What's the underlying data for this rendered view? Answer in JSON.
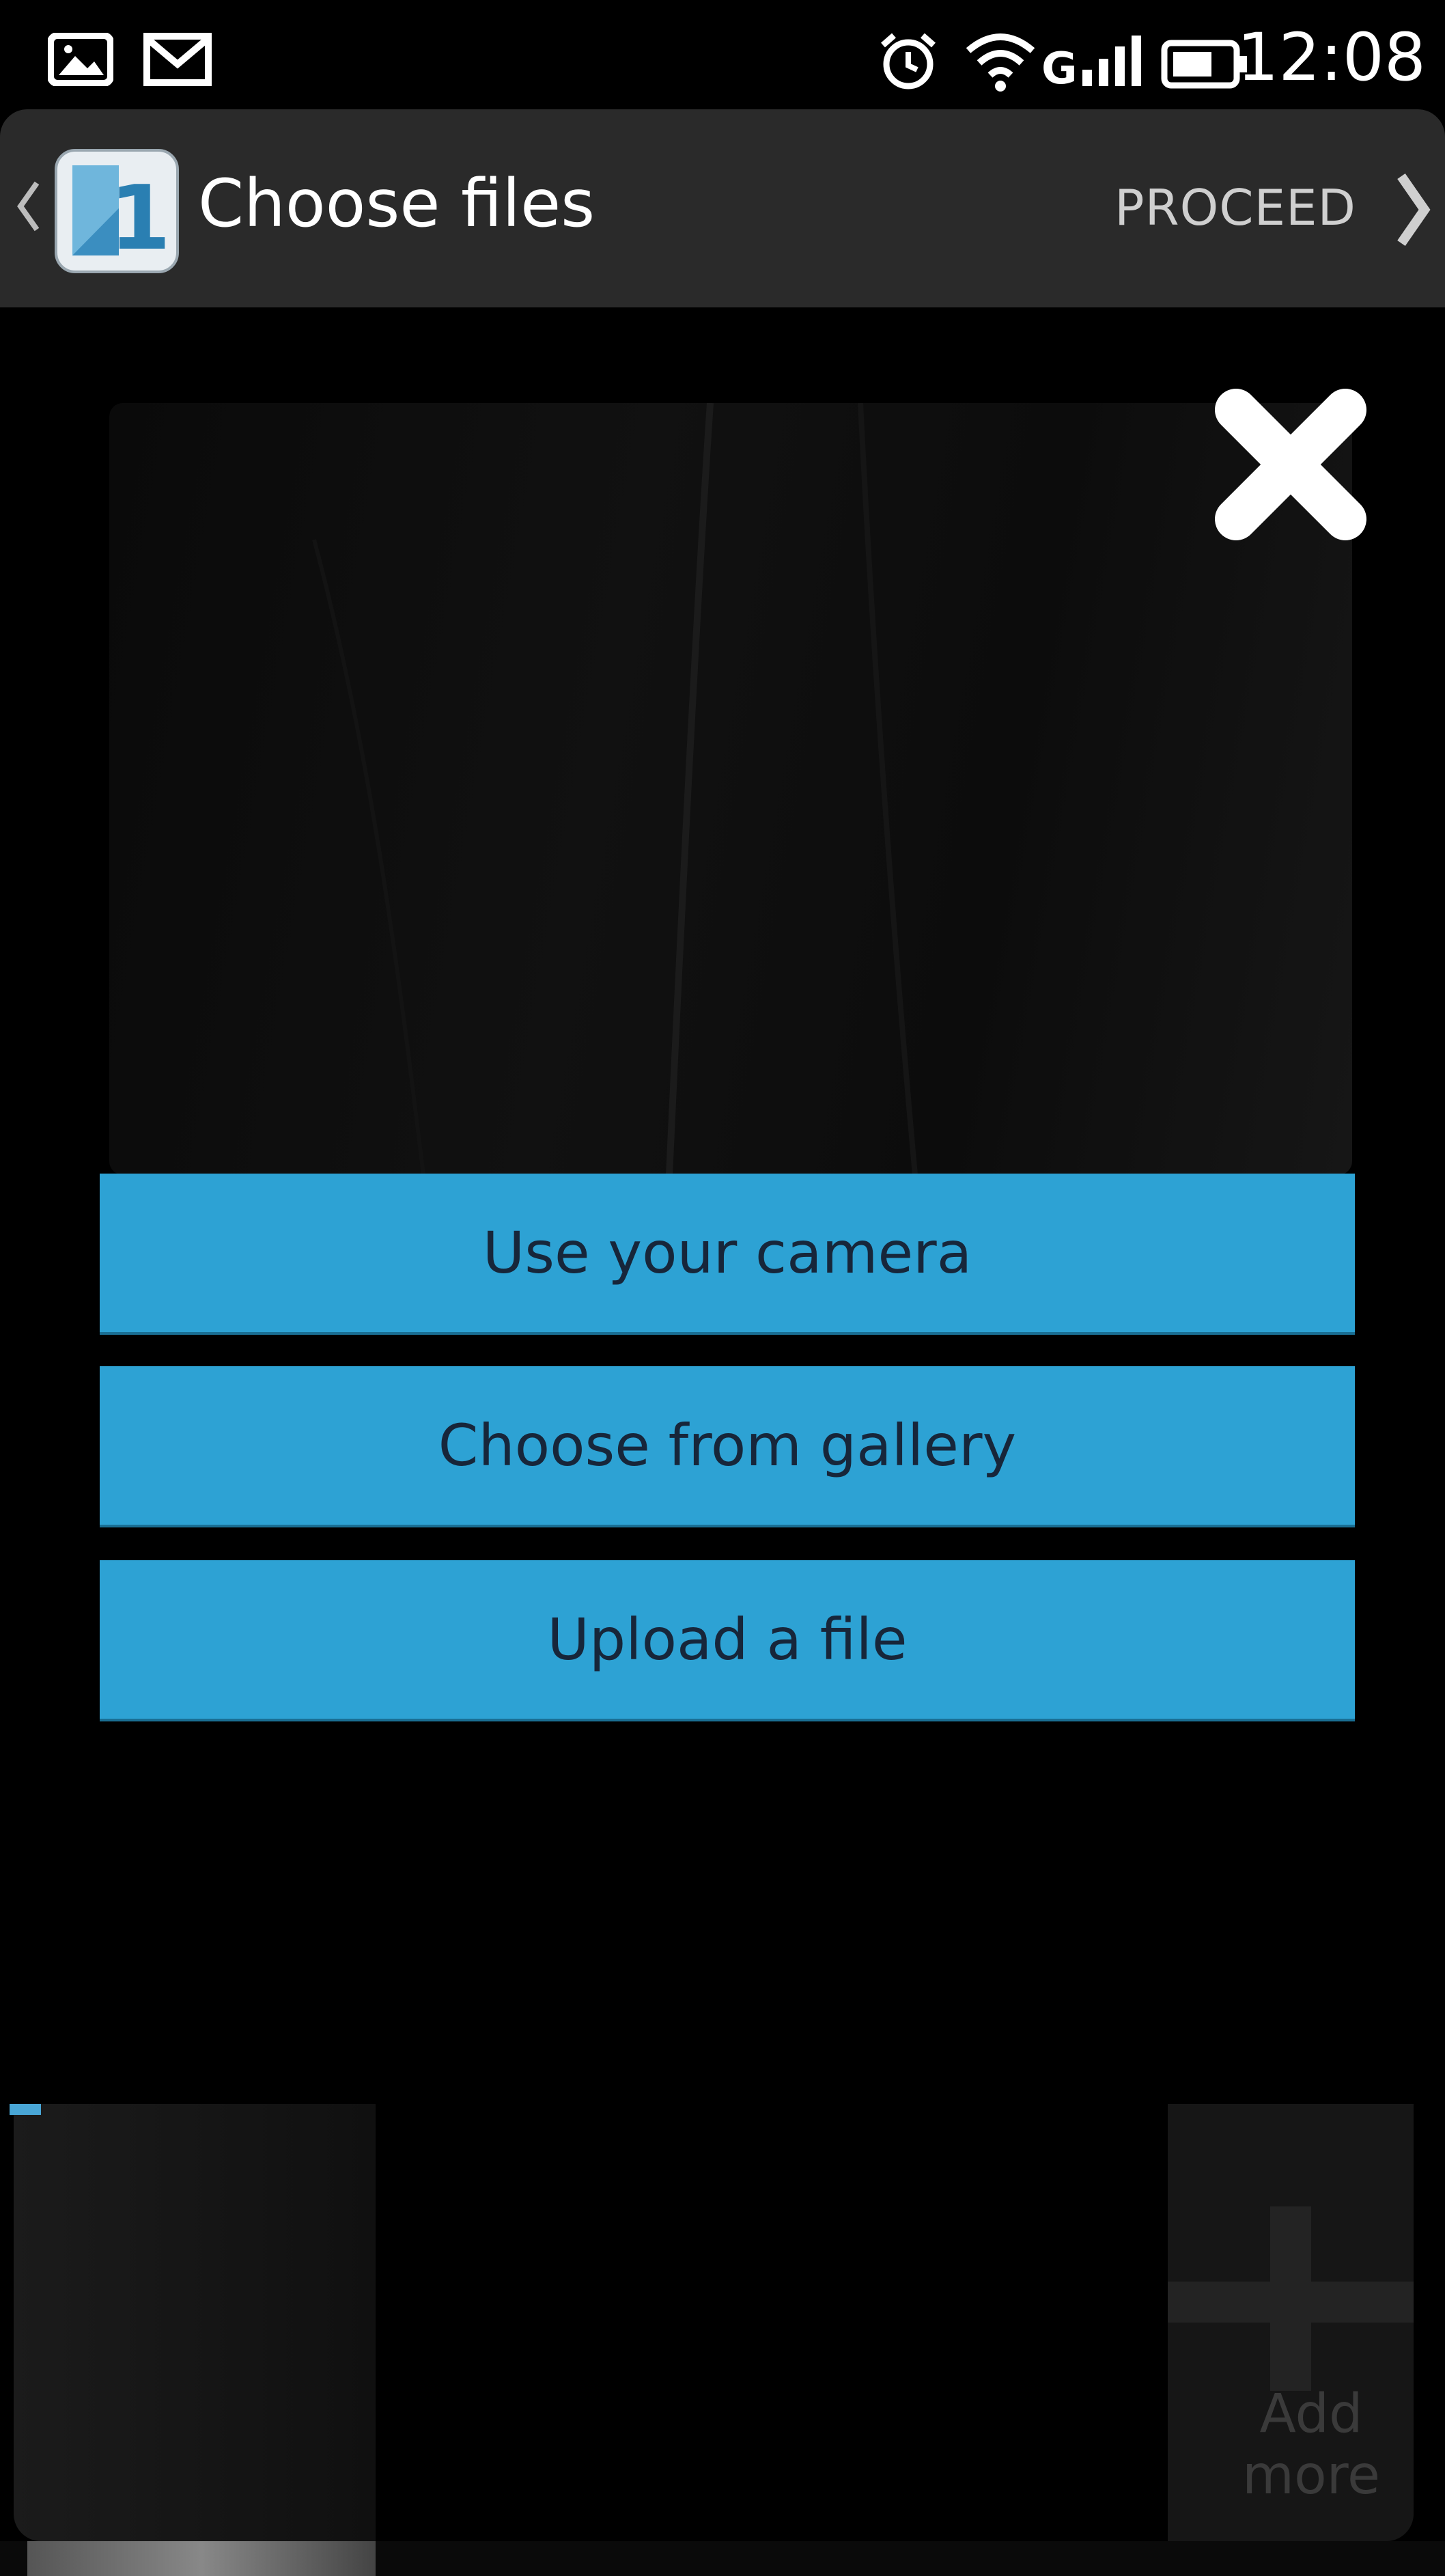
{
  "status_bar": {
    "time": "12:08",
    "icons": [
      "image-icon",
      "gmail-icon",
      "alarm-icon",
      "wifi-icon",
      "signal-icon",
      "battery-icon"
    ]
  },
  "action_bar": {
    "title": "Choose files",
    "proceed_label": "PROCEED",
    "badge_number": "1"
  },
  "options": {
    "camera_label": "Use your camera",
    "gallery_label": "Choose from gallery",
    "upload_label": "Upload a file"
  },
  "thumbnails": {
    "add_more_label": "Add\nmore"
  },
  "colors": {
    "accent": "#2da2d4",
    "action_bar": "#2a2a2a",
    "background": "#000000"
  }
}
